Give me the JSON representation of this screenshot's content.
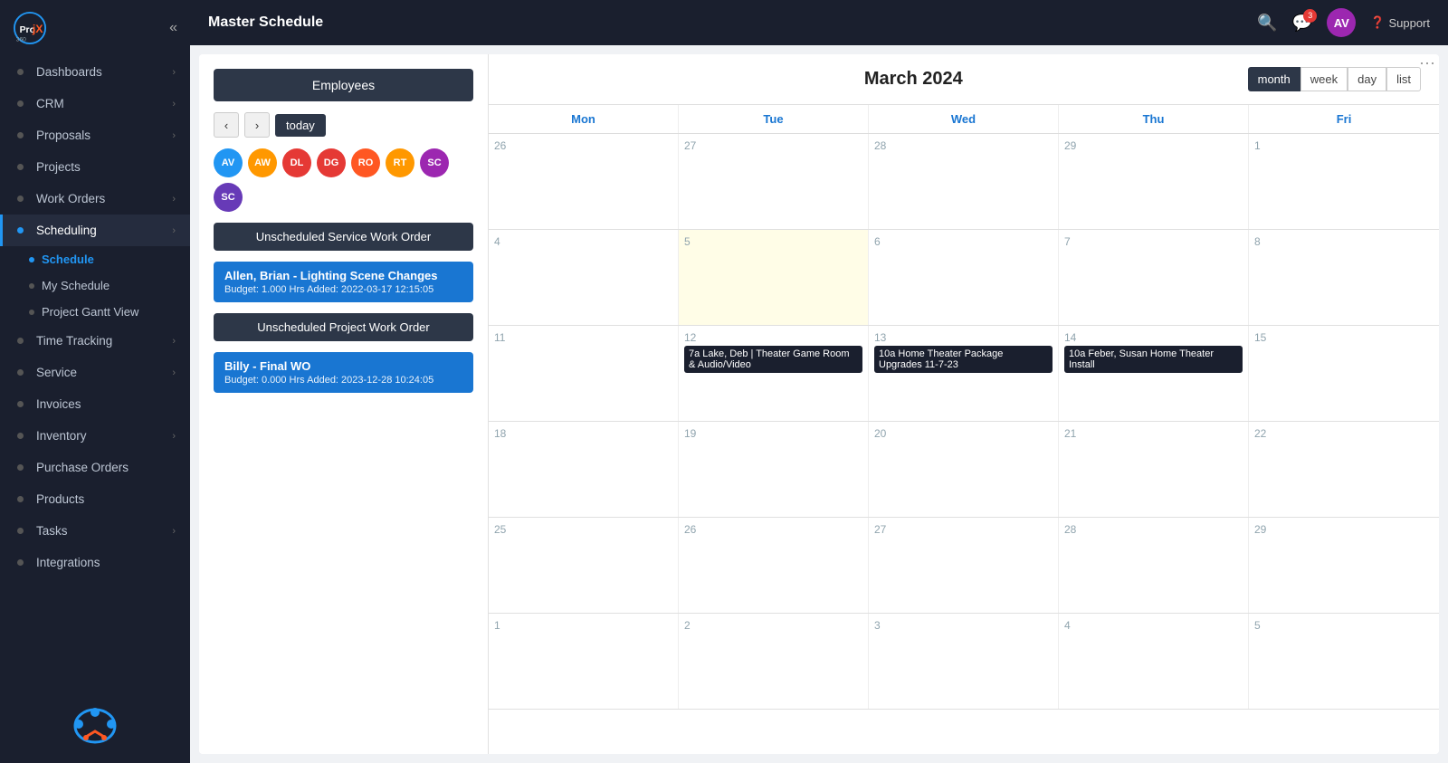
{
  "app": {
    "name": "ProjX360",
    "page_title": "Master Schedule"
  },
  "topbar": {
    "title": "Master Schedule",
    "avatar": "AV",
    "avatar_color": "#9c27b0",
    "support_label": "Support",
    "notification_count": "3"
  },
  "sidebar": {
    "collapse_icon": "‹‹",
    "items": [
      {
        "id": "dashboards",
        "label": "Dashboards",
        "has_chevron": true,
        "active": false
      },
      {
        "id": "crm",
        "label": "CRM",
        "has_chevron": true,
        "active": false
      },
      {
        "id": "proposals",
        "label": "Proposals",
        "has_chevron": true,
        "active": false
      },
      {
        "id": "projects",
        "label": "Projects",
        "has_chevron": false,
        "active": false
      },
      {
        "id": "work-orders",
        "label": "Work Orders",
        "has_chevron": true,
        "active": false
      },
      {
        "id": "scheduling",
        "label": "Scheduling",
        "has_chevron": true,
        "active": true
      },
      {
        "id": "time-tracking",
        "label": "Time Tracking",
        "has_chevron": true,
        "active": false
      },
      {
        "id": "service",
        "label": "Service",
        "has_chevron": true,
        "active": false
      },
      {
        "id": "invoices",
        "label": "Invoices",
        "has_chevron": false,
        "active": false
      },
      {
        "id": "inventory",
        "label": "Inventory",
        "has_chevron": true,
        "active": false
      },
      {
        "id": "purchase-orders",
        "label": "Purchase Orders",
        "has_chevron": false,
        "active": false
      },
      {
        "id": "products",
        "label": "Products",
        "has_chevron": false,
        "active": false
      },
      {
        "id": "tasks",
        "label": "Tasks",
        "has_chevron": true,
        "active": false
      },
      {
        "id": "integrations",
        "label": "Integrations",
        "has_chevron": false,
        "active": false
      }
    ],
    "sub_items": [
      {
        "id": "schedule",
        "label": "Schedule",
        "active": true
      },
      {
        "id": "my-schedule",
        "label": "My Schedule",
        "active": false
      },
      {
        "id": "project-gantt",
        "label": "Project Gantt View",
        "active": false
      }
    ]
  },
  "left_panel": {
    "employees_btn": "Employees",
    "today_btn": "today",
    "avatars": [
      {
        "initials": "AV",
        "color": "#2196f3"
      },
      {
        "initials": "AW",
        "color": "#ff9800"
      },
      {
        "initials": "DL",
        "color": "#e53935"
      },
      {
        "initials": "DG",
        "color": "#e53935"
      },
      {
        "initials": "RO",
        "color": "#ff5722"
      },
      {
        "initials": "RT",
        "color": "#ff9800"
      },
      {
        "initials": "SC",
        "color": "#9c27b0"
      },
      {
        "initials": "SC2",
        "display": "SC",
        "color": "#673ab7"
      }
    ],
    "unscheduled_service_btn": "Unscheduled Service Work Order",
    "service_card": {
      "title": "Allen, Brian - Lighting Scene Changes",
      "budget": "Budget: 1.000 Hrs",
      "added": "Added: 2022-03-17 12:15:05"
    },
    "unscheduled_project_btn": "Unscheduled Project Work Order",
    "project_card": {
      "title": "Billy - Final WO",
      "budget": "Budget: 0.000 Hrs",
      "added": "Added: 2023-12-28 10:24:05"
    }
  },
  "calendar": {
    "month_year": "March 2024",
    "view_buttons": [
      {
        "id": "month",
        "label": "month",
        "active": true
      },
      {
        "id": "week",
        "label": "week",
        "active": false
      },
      {
        "id": "day",
        "label": "day",
        "active": false
      },
      {
        "id": "list",
        "label": "list",
        "active": false
      }
    ],
    "day_headers": [
      "Mon",
      "Tue",
      "Wed",
      "Thu",
      "Fri"
    ],
    "weeks": [
      {
        "days": [
          {
            "date": "26",
            "today": false,
            "events": []
          },
          {
            "date": "27",
            "today": false,
            "events": []
          },
          {
            "date": "28",
            "today": false,
            "events": []
          },
          {
            "date": "29",
            "today": false,
            "events": []
          },
          {
            "date": "1",
            "today": false,
            "events": []
          }
        ]
      },
      {
        "days": [
          {
            "date": "4",
            "today": false,
            "events": []
          },
          {
            "date": "5",
            "today": true,
            "events": []
          },
          {
            "date": "6",
            "today": false,
            "events": []
          },
          {
            "date": "7",
            "today": false,
            "events": []
          },
          {
            "date": "8",
            "today": false,
            "events": []
          }
        ]
      },
      {
        "days": [
          {
            "date": "11",
            "today": false,
            "events": []
          },
          {
            "date": "12",
            "today": false,
            "events": [
              {
                "type": "dark",
                "text": "7a Lake, Deb | Theater Game Room & Audio/Video"
              }
            ]
          },
          {
            "date": "13",
            "today": false,
            "events": [
              {
                "type": "dark",
                "text": "10a Home Theater Package Upgrades 11-7-23"
              }
            ]
          },
          {
            "date": "14",
            "today": false,
            "events": [
              {
                "type": "dark",
                "text": "10a Feber, Susan Home Theater Install"
              }
            ]
          },
          {
            "date": "15",
            "today": false,
            "events": []
          }
        ]
      },
      {
        "days": [
          {
            "date": "18",
            "today": false,
            "events": []
          },
          {
            "date": "19",
            "today": false,
            "events": []
          },
          {
            "date": "20",
            "today": false,
            "events": []
          },
          {
            "date": "21",
            "today": false,
            "events": []
          },
          {
            "date": "22",
            "today": false,
            "events": []
          }
        ]
      },
      {
        "days": [
          {
            "date": "25",
            "today": false,
            "events": []
          },
          {
            "date": "26",
            "today": false,
            "events": []
          },
          {
            "date": "27",
            "today": false,
            "events": []
          },
          {
            "date": "28",
            "today": false,
            "events": []
          },
          {
            "date": "29",
            "today": false,
            "events": []
          }
        ]
      },
      {
        "days": [
          {
            "date": "1",
            "today": false,
            "events": []
          },
          {
            "date": "2",
            "today": false,
            "events": []
          },
          {
            "date": "3",
            "today": false,
            "events": []
          },
          {
            "date": "4",
            "today": false,
            "events": []
          },
          {
            "date": "5",
            "today": false,
            "events": []
          }
        ]
      }
    ]
  }
}
